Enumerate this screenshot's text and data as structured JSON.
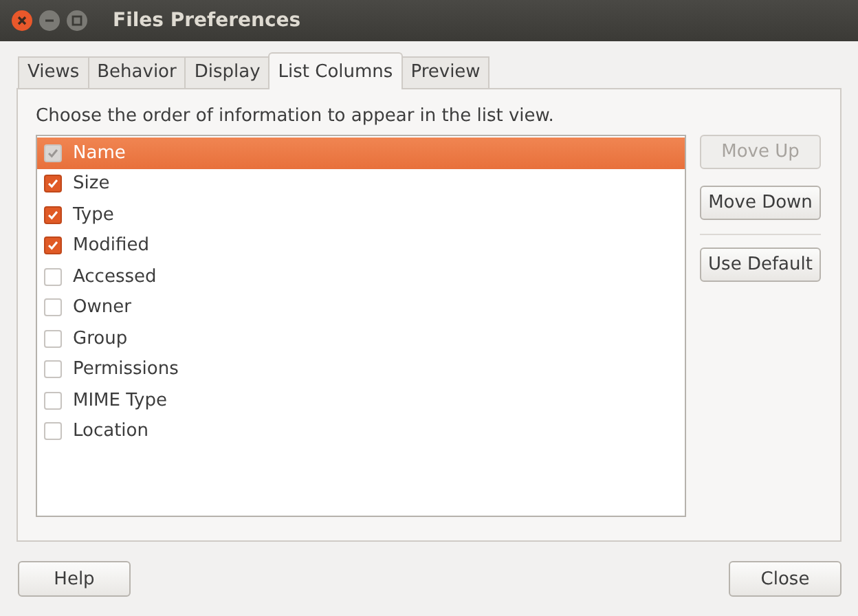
{
  "window": {
    "title": "Files Preferences"
  },
  "tabs": [
    {
      "label": "Views",
      "selected": false
    },
    {
      "label": "Behavior",
      "selected": false
    },
    {
      "label": "Display",
      "selected": false
    },
    {
      "label": "List Columns",
      "selected": true
    },
    {
      "label": "Preview",
      "selected": false
    }
  ],
  "instruction": "Choose the order of information to appear in the list view.",
  "columns": [
    {
      "label": "Name",
      "checked": true,
      "disabled": true,
      "selected": true
    },
    {
      "label": "Size",
      "checked": true,
      "disabled": false,
      "selected": false
    },
    {
      "label": "Type",
      "checked": true,
      "disabled": false,
      "selected": false
    },
    {
      "label": "Modified",
      "checked": true,
      "disabled": false,
      "selected": false
    },
    {
      "label": "Accessed",
      "checked": false,
      "disabled": false,
      "selected": false
    },
    {
      "label": "Owner",
      "checked": false,
      "disabled": false,
      "selected": false
    },
    {
      "label": "Group",
      "checked": false,
      "disabled": false,
      "selected": false
    },
    {
      "label": "Permissions",
      "checked": false,
      "disabled": false,
      "selected": false
    },
    {
      "label": "MIME Type",
      "checked": false,
      "disabled": false,
      "selected": false
    },
    {
      "label": "Location",
      "checked": false,
      "disabled": false,
      "selected": false
    }
  ],
  "side_buttons": [
    {
      "label": "Move Up",
      "disabled": true
    },
    {
      "label": "Move Down",
      "disabled": false
    },
    {
      "label": "Use Default",
      "disabled": false
    }
  ],
  "footer_buttons": [
    {
      "label": "Help"
    },
    {
      "label": "Close"
    }
  ]
}
